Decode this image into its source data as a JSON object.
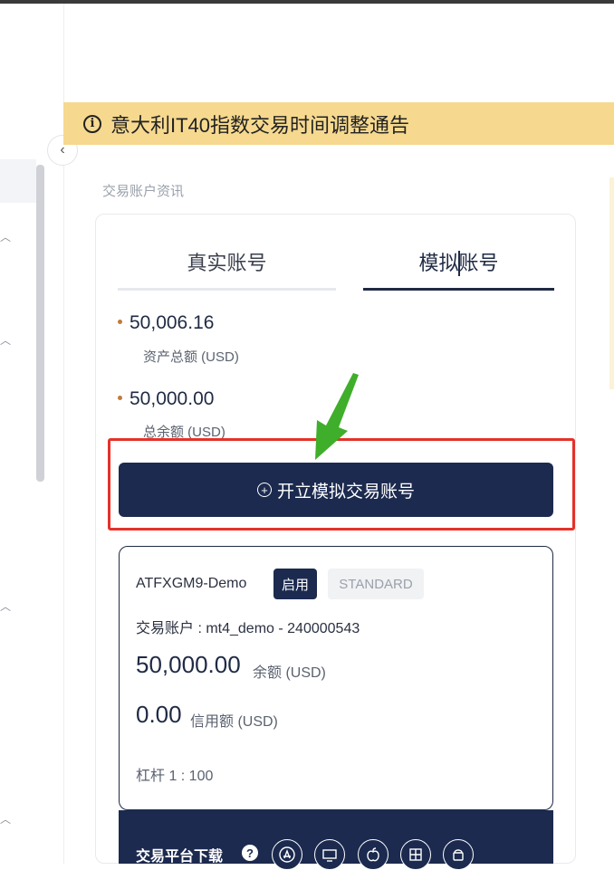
{
  "notice": {
    "icon": "info-circle-icon",
    "text": "意大利IT40指数交易时间调整通告"
  },
  "section": {
    "label": "交易账户资讯"
  },
  "tabs": [
    {
      "label": "真实账号",
      "active": false
    },
    {
      "label": "模拟账号",
      "active": true
    }
  ],
  "stats": [
    {
      "value": "50,006.16",
      "label": "资产总额 (USD)"
    },
    {
      "value": "50,000.00",
      "label": "总余额 (USD)"
    }
  ],
  "open_account_button": {
    "icon": "plus-circle-icon",
    "label": "开立模拟交易账号"
  },
  "account": {
    "name": "ATFXGM9-Demo",
    "status_badge": "启用",
    "type_badge": "STANDARD",
    "account_line": "交易账户 : mt4_demo - 240000543",
    "balance_value": "50,000.00",
    "balance_label": "余额 (USD)",
    "credit_value": "0.00",
    "credit_label": "信用额 (USD)",
    "leverage": "杠杆 1 : 100"
  },
  "download": {
    "label": "交易平台下载",
    "help_icon": "question-icon",
    "platforms": [
      "app-store-icon",
      "desktop-icon",
      "apple-icon",
      "windows-icon",
      "android-icon"
    ]
  },
  "colors": {
    "navy": "#1c2a4f",
    "notice_bg": "#f6d98f",
    "highlight_red": "#e5312a",
    "arrow_green": "#3fae2a",
    "bullet": "#c27a3a"
  }
}
